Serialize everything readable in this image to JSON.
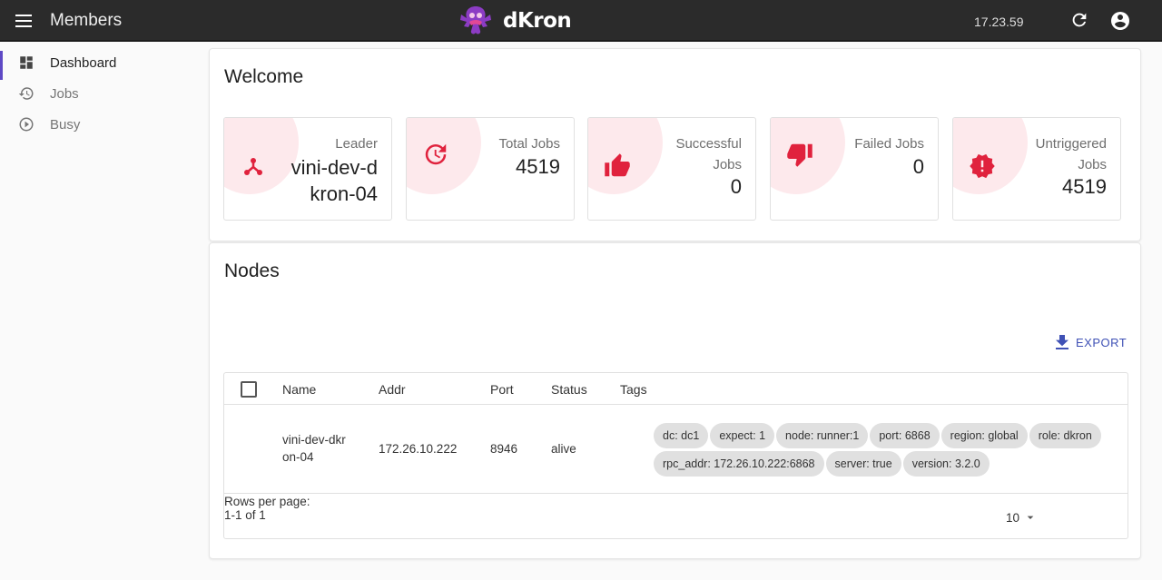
{
  "appbar": {
    "title": "Members",
    "logo_text": "dKron",
    "time": "17.23.59",
    "menu_icon": "hamburger-menu-icon",
    "refresh_icon": "refresh-icon",
    "account_icon": "account-circle-icon"
  },
  "sidebar": {
    "items": [
      {
        "label": "Dashboard",
        "icon": "dashboard-icon",
        "active": true
      },
      {
        "label": "Jobs",
        "icon": "history-icon",
        "active": false
      },
      {
        "label": "Busy",
        "icon": "play-circle-icon",
        "active": false
      }
    ]
  },
  "welcome": {
    "title": "Welcome",
    "stats": [
      {
        "label": "Leader",
        "value": "vini-dev-dkron-04",
        "icon": "leader-branch-icon"
      },
      {
        "label": "Total Jobs",
        "value": "4519",
        "icon": "update-clock-icon"
      },
      {
        "label": "Successful Jobs",
        "value": "0",
        "icon": "thumb-up-icon"
      },
      {
        "label": "Failed Jobs",
        "value": "0",
        "icon": "thumb-down-icon"
      },
      {
        "label": "Untriggered Jobs",
        "value": "4519",
        "icon": "alert-badge-icon"
      }
    ]
  },
  "nodes": {
    "title": "Nodes",
    "export_label": "EXPORT",
    "columns": [
      "Name",
      "Addr",
      "Port",
      "Status",
      "Tags"
    ],
    "rows": [
      {
        "name": "vini-dev-dkron-04",
        "addr": "172.26.10.222",
        "port": "8946",
        "status": "alive",
        "tags": [
          "dc: dc1",
          "expect: 1",
          "node: runner:1",
          "port: 6868",
          "region: global",
          "role: dkron",
          "rpc_addr: 172.26.10.222:6868",
          "server: true",
          "version: 3.2.0"
        ]
      }
    ],
    "rows_per_page_label": "Rows per page:",
    "rows_per_page_value": "10",
    "pagination": "1-1 of 1"
  },
  "colors": {
    "accent": "#5e49c5",
    "stat_icon": "#e0223d",
    "stat_blob": "#fde9ec",
    "appbar": "#2b2b2b",
    "link": "#3f51b5"
  }
}
